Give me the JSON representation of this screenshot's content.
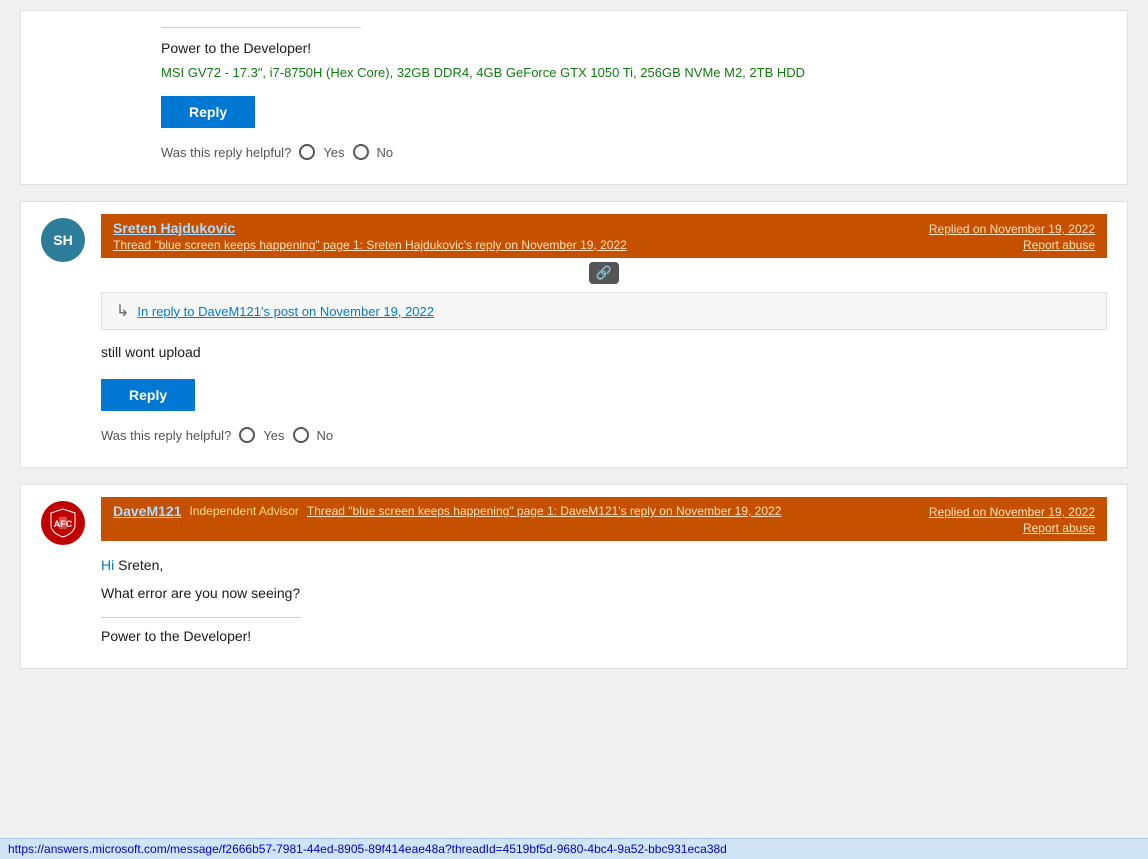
{
  "page": {
    "background_color": "#f0f0f0"
  },
  "card1": {
    "divider": true,
    "power_text": "Power to the Developer!",
    "specs_text": "MSI GV72 - 17.3\", i7-8750H (Hex Core), 32GB DDR4, 4GB GeForce GTX 1050 Ti, 256GB NVMe M2, 2TB HDD",
    "reply_btn": "Reply",
    "helpful_label": "Was this reply helpful?",
    "yes_label": "Yes",
    "no_label": "No"
  },
  "card2": {
    "avatar_initials": "SH",
    "username": "Sreten Hajdukovic",
    "replied_date": "Replied on November 19, 2022",
    "thread_link": "Thread \"blue screen keeps happening\" page 1:  Sreten Hajdukovic's reply on November 19, 2022",
    "report_abuse": "Report abuse",
    "link_icon": "🔗",
    "reply_to_text": "In reply to DaveM121's post on November 19, 2022",
    "body_text": "still wont upload",
    "reply_btn": "Reply",
    "helpful_label": "Was this reply helpful?",
    "yes_label": "Yes",
    "no_label": "No"
  },
  "card3": {
    "username": "DaveM121",
    "badge": "Independent Advisor",
    "replied_date": "Replied on November 19, 2022",
    "thread_link": "Thread \"blue screen keeps happening\" page 1:  DaveM121's reply on November 19, 2022",
    "report_abuse": "Report abuse",
    "greeting_hi": "Hi",
    "greeting_name": " Sreten,",
    "body_line1": "What error are you now seeing?",
    "power_text": "Power to the Developer!"
  },
  "status_bar": {
    "url": "https://answers.microsoft.com/message/f2666b57-7981-44ed-8905-89f414eae48a?threadId=4519bf5d-9680-4bc4-9a52-bbc931eca38d"
  }
}
